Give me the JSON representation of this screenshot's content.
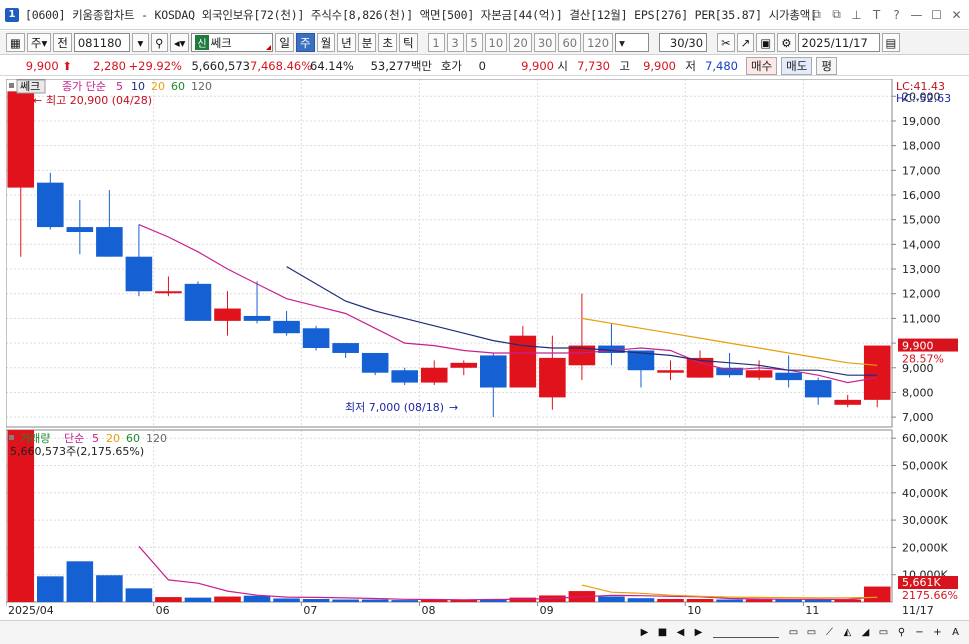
{
  "titlebar": {
    "app_icon": "1",
    "title": "[0600] 키움종합차트 - KOSDAQ 외국인보유[72(천)] 주식수[8,826(천)] 액면[500] 자본금[44(억)] 결산[12월] EPS[276] PER[35.87] 시가총액[",
    "buttons": [
      "⧉",
      "⧉",
      "⊥",
      "T",
      "?",
      "—",
      "☐",
      "✕"
    ]
  },
  "toolbar": {
    "period_type": "주",
    "prev_label": "전",
    "code": "081180",
    "name_badge": "신",
    "name": "쎄크",
    "periods": [
      "일",
      "주",
      "월",
      "년",
      "분",
      "초",
      "틱"
    ],
    "active_period": "주",
    "intervals": [
      "1",
      "3",
      "5",
      "10",
      "20",
      "30",
      "60",
      "120"
    ],
    "count": "30/30",
    "date": "2025/11/17"
  },
  "pricebar": {
    "price": "9,900",
    "change": "2,280",
    "change_pct": "+29.92%",
    "volume": "5,660,573",
    "volume_pct": "7,468.46%",
    "turnover": "64.14%",
    "amount": "53,277백만",
    "quote_label": "호가",
    "quote_value": "0",
    "ask": "9,900",
    "open_label": "시",
    "open": "7,730",
    "high_label": "고",
    "high": "9,900",
    "low_label": "저",
    "low": "7,480",
    "buy_label": "매수",
    "sell_label": "매도",
    "eval_label": "평"
  },
  "price_panel": {
    "tag": "쎄크",
    "ma_legend": {
      "label": "종가 단순",
      "periods": [
        "5",
        "10",
        "20",
        "60",
        "120"
      ]
    },
    "ma_colors": [
      "#c8208f",
      "#1f2d7a",
      "#e89e0b",
      "#1c8a2e",
      "#666666"
    ],
    "high_annot": "최고 20,900 (04/28)",
    "low_annot": "최저 7,000 (08/18)",
    "lc": "LC:41.43",
    "hc": "HC:-52.63",
    "current_price": "9,900",
    "current_pct": "28.57%",
    "y_labels": [
      "20,000",
      "19,000",
      "18,000",
      "17,000",
      "16,000",
      "15,000",
      "14,000",
      "13,000",
      "12,000",
      "11,000",
      "10,000",
      "9,000",
      "8,000",
      "7,000"
    ]
  },
  "volume_panel": {
    "label": "거래량",
    "ma_legend": {
      "label": "단순",
      "periods": [
        "5",
        "20",
        "60",
        "120"
      ]
    },
    "ma_colors": [
      "#c8208f",
      "#e89e0b",
      "#1c8a2e",
      "#666666"
    ],
    "current_text": "5,660,573주(2,175.65%)",
    "current_badge": "5,661K",
    "current_pct": "2175.66%",
    "y_labels": [
      "60,000K",
      "50,000K",
      "40,000K",
      "30,000K",
      "20,000K",
      "10,000K"
    ]
  },
  "x_axis": {
    "labels": [
      "2025/04",
      "06",
      "07",
      "08",
      "09",
      "10",
      "11"
    ],
    "right_label": "11/17"
  },
  "chart_data": {
    "type": "candlestick",
    "price_ylim": [
      6600,
      20700
    ],
    "volume_ylim": [
      0,
      63000
    ],
    "candles": [
      {
        "o": 16300,
        "h": 20900,
        "l": 13500,
        "c": 20200,
        "v": 63000
      },
      {
        "o": 16500,
        "h": 16900,
        "l": 14600,
        "c": 14700,
        "v": 9400
      },
      {
        "o": 14700,
        "h": 15800,
        "l": 13600,
        "c": 14500,
        "v": 14900
      },
      {
        "o": 14700,
        "h": 16200,
        "l": 13500,
        "c": 13500,
        "v": 9800
      },
      {
        "o": 13500,
        "h": 14800,
        "l": 11900,
        "c": 12100,
        "v": 5000
      },
      {
        "o": 12100,
        "h": 12700,
        "l": 11900,
        "c": 12100,
        "v": 1800
      },
      {
        "o": 12400,
        "h": 12500,
        "l": 10900,
        "c": 10900,
        "v": 1600
      },
      {
        "o": 10900,
        "h": 12100,
        "l": 10300,
        "c": 11400,
        "v": 2000
      },
      {
        "o": 11100,
        "h": 12500,
        "l": 10800,
        "c": 10900,
        "v": 2300
      },
      {
        "o": 10900,
        "h": 11300,
        "l": 10300,
        "c": 10400,
        "v": 1300
      },
      {
        "o": 10600,
        "h": 10700,
        "l": 9700,
        "c": 9800,
        "v": 1100
      },
      {
        "o": 10000,
        "h": 10000,
        "l": 9400,
        "c": 9600,
        "v": 900
      },
      {
        "o": 9600,
        "h": 9600,
        "l": 8700,
        "c": 8800,
        "v": 900
      },
      {
        "o": 8900,
        "h": 9000,
        "l": 8300,
        "c": 8400,
        "v": 700
      },
      {
        "o": 8400,
        "h": 9300,
        "l": 8300,
        "c": 9000,
        "v": 900
      },
      {
        "o": 9000,
        "h": 9300,
        "l": 8700,
        "c": 9200,
        "v": 800
      },
      {
        "o": 9500,
        "h": 9600,
        "l": 7000,
        "c": 8200,
        "v": 900
      },
      {
        "o": 8200,
        "h": 10700,
        "l": 8200,
        "c": 10300,
        "v": 1600
      },
      {
        "o": 7800,
        "h": 10300,
        "l": 7300,
        "c": 9400,
        "v": 2400
      },
      {
        "o": 9100,
        "h": 12000,
        "l": 8500,
        "c": 9900,
        "v": 4000
      },
      {
        "o": 9900,
        "h": 10800,
        "l": 9100,
        "c": 9600,
        "v": 2000
      },
      {
        "o": 9700,
        "h": 9700,
        "l": 8200,
        "c": 8900,
        "v": 1400
      },
      {
        "o": 8800,
        "h": 9300,
        "l": 8500,
        "c": 8900,
        "v": 1100
      },
      {
        "o": 8600,
        "h": 9700,
        "l": 8600,
        "c": 9400,
        "v": 1100
      },
      {
        "o": 9000,
        "h": 9600,
        "l": 8600,
        "c": 8700,
        "v": 900
      },
      {
        "o": 8600,
        "h": 9300,
        "l": 8500,
        "c": 8900,
        "v": 900
      },
      {
        "o": 8800,
        "h": 9500,
        "l": 8200,
        "c": 8500,
        "v": 1000
      },
      {
        "o": 8500,
        "h": 8600,
        "l": 7500,
        "c": 7800,
        "v": 900
      },
      {
        "o": 7500,
        "h": 7900,
        "l": 7400,
        "c": 7700,
        "v": 900
      },
      {
        "o": 7700,
        "h": 9900,
        "l": 7400,
        "c": 9900,
        "v": 5661
      }
    ],
    "ma5": [
      null,
      null,
      null,
      null,
      14800,
      14300,
      13700,
      13000,
      12400,
      11800,
      11500,
      11200,
      10600,
      10000,
      9900,
      9700,
      9600,
      9600,
      9600,
      9600,
      9700,
      9800,
      9700,
      9200,
      8900,
      9000,
      8900,
      8700,
      8400,
      8600
    ],
    "ma10": [
      null,
      null,
      null,
      null,
      null,
      null,
      null,
      null,
      null,
      13100,
      12400,
      11700,
      11300,
      11000,
      10700,
      10400,
      10100,
      9900,
      9800,
      9800,
      9700,
      9600,
      9500,
      9300,
      9200,
      9100,
      8900,
      8900,
      8700,
      8700
    ],
    "ma20": [
      null,
      null,
      null,
      null,
      null,
      null,
      null,
      null,
      null,
      null,
      null,
      null,
      null,
      null,
      null,
      null,
      null,
      null,
      null,
      11000,
      10800,
      10600,
      10400,
      10200,
      10000,
      9800,
      9600,
      9400,
      9200,
      9100
    ],
    "vma5": [
      null,
      null,
      null,
      null,
      20400,
      8100,
      6900,
      4000,
      2500,
      1800,
      1700,
      1500,
      1300,
      1000,
      900,
      800,
      900,
      1000,
      1300,
      1900,
      2400,
      2300,
      2100,
      1900,
      1300,
      1100,
      1000,
      1000,
      900,
      1900
    ],
    "vma20": [
      null,
      null,
      null,
      null,
      null,
      null,
      null,
      null,
      null,
      null,
      null,
      null,
      null,
      null,
      null,
      null,
      null,
      null,
      null,
      6200,
      3600,
      3200,
      2500,
      2100,
      1800,
      1700,
      1600,
      1500,
      1500,
      1700
    ]
  }
}
